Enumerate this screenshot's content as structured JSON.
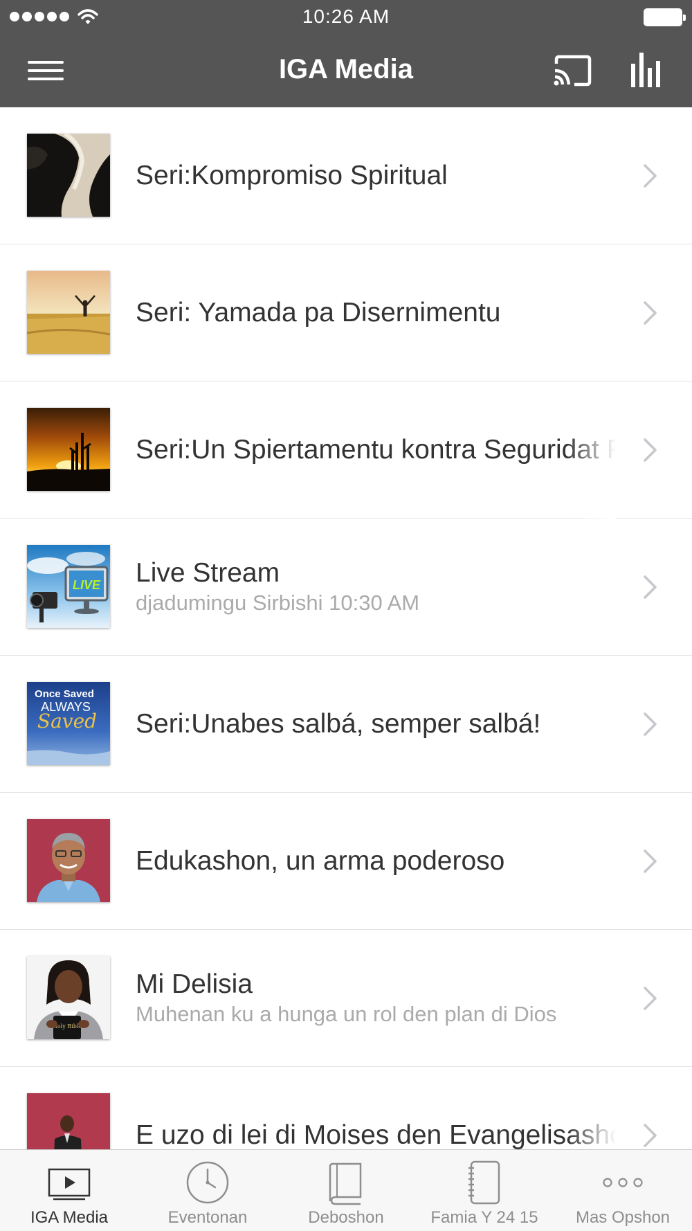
{
  "status_bar": {
    "time": "10:26 AM"
  },
  "nav": {
    "title": "IGA Media"
  },
  "items": [
    {
      "title": "Seri:Kompromiso Spiritual",
      "subtitle": ""
    },
    {
      "title": "Seri: Yamada pa Disernimentu",
      "subtitle": ""
    },
    {
      "title": "Seri:Un Spiertamentu kontra Seguridat Fal",
      "subtitle": ""
    },
    {
      "title": "Live Stream",
      "subtitle": "djadumingu  Sirbishi 10:30 AM"
    },
    {
      "title": "Seri:Unabes salbá, semper salbá!",
      "subtitle": ""
    },
    {
      "title": "Edukashon, un arma poderoso",
      "subtitle": ""
    },
    {
      "title": "Mi Delisia",
      "subtitle": "Muhenan ku a hunga un rol den plan di Dios"
    },
    {
      "title": "E uzo di lei di Moises den Evangelisashon",
      "subtitle": ""
    }
  ],
  "thumb_text": {
    "live": "LIVE",
    "saved_line1": "Once Saved",
    "saved_line2": "ALWAYS",
    "saved_line3": "Saved",
    "bible": "Holy Bible"
  },
  "tabs": [
    {
      "label": "IGA Media",
      "icon": "video-icon",
      "active": true
    },
    {
      "label": "Eventonan",
      "icon": "clock-icon",
      "active": false
    },
    {
      "label": "Deboshon",
      "icon": "book-icon",
      "active": false
    },
    {
      "label": "Famia Y 24 15",
      "icon": "notebook-icon",
      "active": false
    },
    {
      "label": "Mas Opshon",
      "icon": "more-icon",
      "active": false
    }
  ],
  "colors": {
    "nav_bar": "#555555",
    "active_tab": "#333333",
    "inactive_tab": "#8e8e8e"
  }
}
